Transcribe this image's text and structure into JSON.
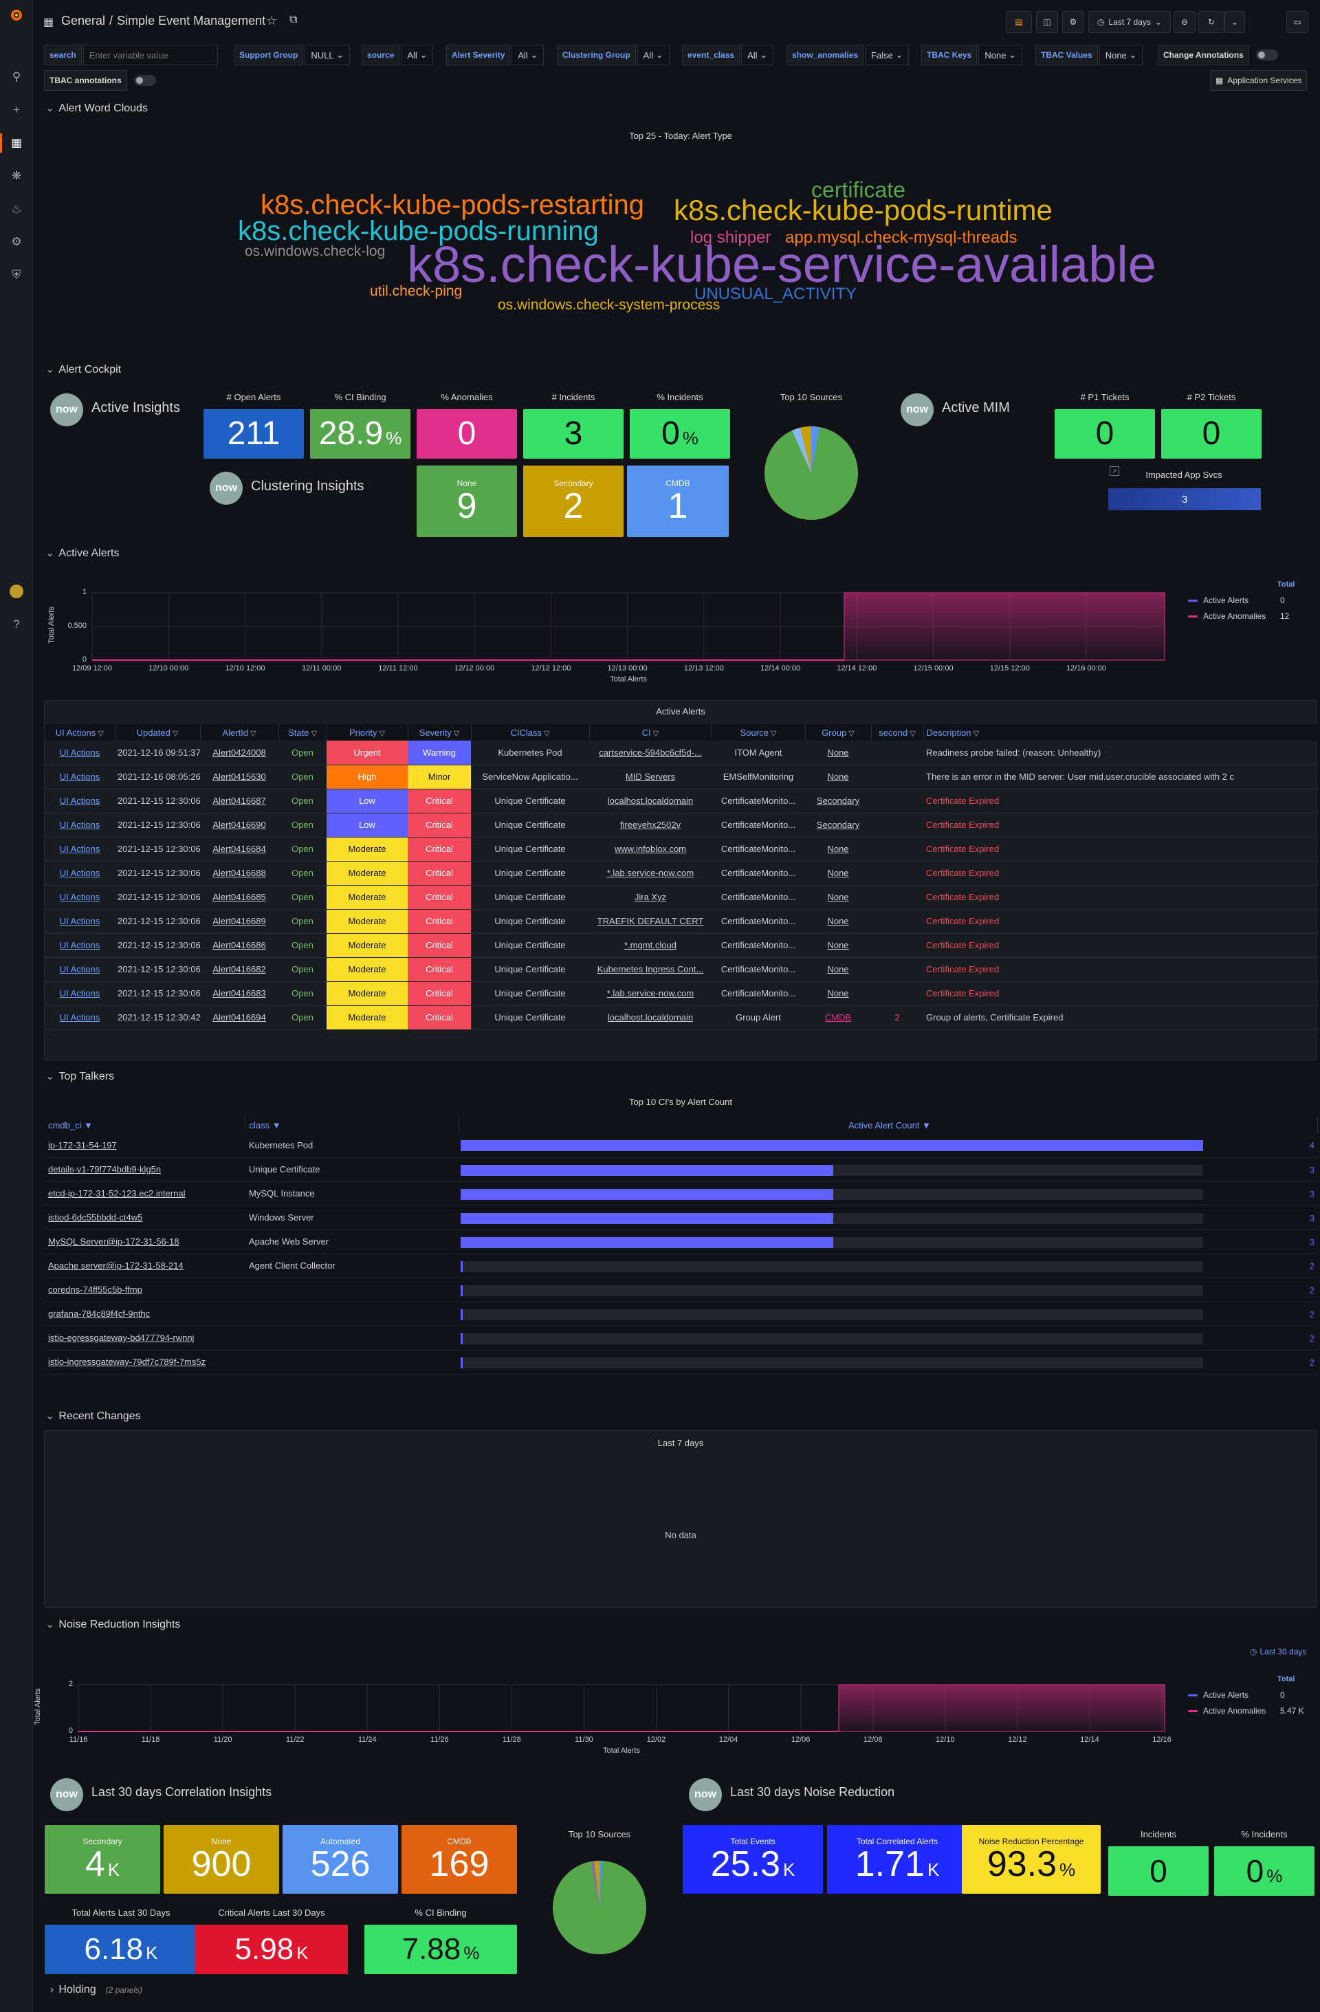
{
  "header": {
    "breadcrumb_folder": "General",
    "breadcrumb_sep": "/",
    "dashboard_title": "Simple Event Management",
    "time_range": "Last 7 days"
  },
  "variables": [
    {
      "label": "search",
      "value": "",
      "placeholder": "Enter variable value"
    },
    {
      "label": "Support Group",
      "value": "NULL"
    },
    {
      "label": "source",
      "value": "All"
    },
    {
      "label": "Alert Severity",
      "value": "All"
    },
    {
      "label": "Clustering Group",
      "value": "All"
    },
    {
      "label": "event_class",
      "value": "All"
    },
    {
      "label": "show_anomalies",
      "value": "False"
    },
    {
      "label": "TBAC Keys",
      "value": "None"
    },
    {
      "label": "TBAC Values",
      "value": "None"
    },
    {
      "label": "Change Annotations",
      "value": ""
    },
    {
      "label": "TBAC annotations",
      "value": ""
    }
  ],
  "app_services_link": "Application Services",
  "rows": {
    "word_clouds": "Alert Word Clouds",
    "cockpit": "Alert Cockpit",
    "active_alerts": "Active Alerts",
    "top_talkers": "Top Talkers",
    "recent_changes": "Recent Changes",
    "noise": "Noise Reduction Insights",
    "holding": "Holding",
    "holding_count": "(2 panels)"
  },
  "word_cloud": {
    "title": "Top 25 - Today: Alert Type",
    "words": [
      {
        "text": "k8s.check-kube-pods-restarting",
        "color": "#ff780a"
      },
      {
        "text": "k8s.check-kube-pods-runtime",
        "color": "#e0b400"
      },
      {
        "text": "certificate",
        "color": "#56a64b"
      },
      {
        "text": "k8s.check-kube-pods-running",
        "color": "#1fc3d6"
      },
      {
        "text": "log shipper",
        "color": "#d44a8a"
      },
      {
        "text": "app.mysql.check-mysql-threads",
        "color": "#ff780a"
      },
      {
        "text": "os.windows.check-log",
        "color": "#8e8e8e"
      },
      {
        "text": "k8s.check-kube-service-available",
        "color": "#8f5fc7"
      },
      {
        "text": "util.check-ping",
        "color": "#ff9830"
      },
      {
        "text": "UNUSUAL_ACTIVITY",
        "color": "#3274d9"
      },
      {
        "text": "os.windows.check-system-process",
        "color": "#e0b400"
      }
    ]
  },
  "cockpit": {
    "active_insights": "Active Insights",
    "clustering_insights": "Clustering Insights",
    "active_mim": "Active MIM",
    "now_logo": "now",
    "stats": [
      {
        "label": "# Open Alerts",
        "value": "211",
        "unit": "",
        "color": "#1f60c4"
      },
      {
        "label": "% CI Binding",
        "value": "28.9",
        "unit": "%",
        "color": "#56a64b"
      },
      {
        "label": "% Anomalies",
        "value": "0",
        "unit": "",
        "color": "#e02f8d"
      },
      {
        "label": "# Incidents",
        "value": "3",
        "unit": "",
        "color": "#37e066"
      },
      {
        "label": "% Incidents",
        "value": "0",
        "unit": "%",
        "color": "#37e066"
      }
    ],
    "groups": [
      {
        "label": "None",
        "value": "9",
        "color": "#56a64b"
      },
      {
        "label": "Secondary",
        "value": "2",
        "color": "#c7a000"
      },
      {
        "label": "CMDB",
        "value": "1",
        "color": "#5794f2"
      }
    ],
    "top_sources_title": "Top 10 Sources",
    "tickets": [
      {
        "label": "# P1 Tickets",
        "value": "0"
      },
      {
        "label": "# P2 Tickets",
        "value": "0"
      }
    ],
    "impacted_title": "Impacted App Svcs",
    "impacted_value": "3"
  },
  "active_alerts_chart": {
    "chart_data": {
      "type": "area",
      "ylabel": "Total Alerts",
      "xlabel": "Total Alerts",
      "x_ticks": [
        "12/09 12:00",
        "12/10 00:00",
        "12/10 12:00",
        "12/11 00:00",
        "12/11 12:00",
        "12/12 00:00",
        "12/12 12:00",
        "12/13 00:00",
        "12/13 12:00",
        "12/14 00:00",
        "12/14 12:00",
        "12/15 00:00",
        "12/15 12:00",
        "12/16 00:00"
      ],
      "y_ticks": [
        "0",
        "0.500",
        "1"
      ],
      "series": [
        {
          "name": "Active Alerts",
          "total": "0",
          "color": "#5f61ff"
        },
        {
          "name": "Active Anomalies",
          "total": "12",
          "color": "#e02f8d"
        }
      ]
    },
    "legend_header": "Total"
  },
  "alerts_table": {
    "title": "Active Alerts",
    "columns": [
      "UI Actions",
      "Updated",
      "AlertId",
      "State",
      "Priority",
      "Severity",
      "CIClass",
      "CI",
      "Source",
      "Group",
      "second",
      "Description"
    ],
    "rows": [
      [
        "UI Actions",
        "2021-12-16 09:51:37.000",
        "Alert0424008",
        "Open",
        "Urgent",
        "Warning",
        "Kubernetes Pod",
        "cartservice-594bc6cf5d-...",
        "ITOM Agent",
        "None",
        "",
        "Readiness probe failed: (reason: Unhealthy)"
      ],
      [
        "UI Actions",
        "2021-12-16 08:05:26.000",
        "Alert0415630",
        "Open",
        "High",
        "Minor",
        "ServiceNow Applicatio...",
        "MID Servers",
        "EMSelfMonitoring",
        "None",
        "",
        "There is an error in the MID server: User mid.user.crucible associated with 2 c"
      ],
      [
        "UI Actions",
        "2021-12-15 12:30:06.000",
        "Alert0416687",
        "Open",
        "Low",
        "Critical",
        "Unique Certificate",
        "localhost.localdomain",
        "CertificateMonito...",
        "Secondary",
        "",
        "Certificate Expired"
      ],
      [
        "UI Actions",
        "2021-12-15 12:30:06.000",
        "Alert0416690",
        "Open",
        "Low",
        "Critical",
        "Unique Certificate",
        "fireeyehx2502v",
        "CertificateMonito...",
        "Secondary",
        "",
        "Certificate Expired"
      ],
      [
        "UI Actions",
        "2021-12-15 12:30:06.000",
        "Alert0416684",
        "Open",
        "Moderate",
        "Critical",
        "Unique Certificate",
        "www.infoblox.com",
        "CertificateMonito...",
        "None",
        "",
        "Certificate Expired"
      ],
      [
        "UI Actions",
        "2021-12-15 12:30:06.000",
        "Alert0416688",
        "Open",
        "Moderate",
        "Critical",
        "Unique Certificate",
        "*.lab.service-now.com",
        "CertificateMonito...",
        "None",
        "",
        "Certificate Expired"
      ],
      [
        "UI Actions",
        "2021-12-15 12:30:06.000",
        "Alert0416685",
        "Open",
        "Moderate",
        "Critical",
        "Unique Certificate",
        "Jira Xyz",
        "CertificateMonito...",
        "None",
        "",
        "Certificate Expired"
      ],
      [
        "UI Actions",
        "2021-12-15 12:30:06.000",
        "Alert0416689",
        "Open",
        "Moderate",
        "Critical",
        "Unique Certificate",
        "TRAEFIK DEFAULT CERT",
        "CertificateMonito...",
        "None",
        "",
        "Certificate Expired"
      ],
      [
        "UI Actions",
        "2021-12-15 12:30:06.000",
        "Alert0416686",
        "Open",
        "Moderate",
        "Critical",
        "Unique Certificate",
        "*.mgmt.cloud",
        "CertificateMonito...",
        "None",
        "",
        "Certificate Expired"
      ],
      [
        "UI Actions",
        "2021-12-15 12:30:06.000",
        "Alert0416682",
        "Open",
        "Moderate",
        "Critical",
        "Unique Certificate",
        "Kubernetes Ingress Cont...",
        "CertificateMonito...",
        "None",
        "",
        "Certificate Expired"
      ],
      [
        "UI Actions",
        "2021-12-15 12:30:06.000",
        "Alert0416683",
        "Open",
        "Moderate",
        "Critical",
        "Unique Certificate",
        "*.lab.service-now.com",
        "CertificateMonito...",
        "None",
        "",
        "Certificate Expired"
      ],
      [
        "UI Actions",
        "2021-12-15 12:30:42.000",
        "Alert0416694",
        "Open",
        "Moderate",
        "Critical",
        "Unique Certificate",
        "localhost.localdomain",
        "Group Alert",
        "CMDB",
        "2",
        "Group of alerts, Certificate Expired"
      ]
    ]
  },
  "top_talkers": {
    "title": "Top 10 CI's by Alert Count",
    "columns": [
      "cmdb_ci",
      "class",
      "Active Alert Count"
    ],
    "rows": [
      {
        "ci": "ip-172-31-54-197",
        "cls": "Kubernetes Pod",
        "count": 4
      },
      {
        "ci": "details-v1-79f774bdb9-klg5n",
        "cls": "Unique Certificate",
        "count": 3
      },
      {
        "ci": "etcd-ip-172-31-52-123.ec2.internal",
        "cls": "MySQL Instance",
        "count": 3
      },
      {
        "ci": "istiod-6dc55bbdd-ct4w5",
        "cls": "Windows Server",
        "count": 3
      },
      {
        "ci": "MySQL Server@ip-172-31-56-18",
        "cls": "Apache Web Server",
        "count": 3
      },
      {
        "ci": "Apache server@ip-172-31-58-214",
        "cls": "Agent Client Collector",
        "count": 2
      },
      {
        "ci": "coredns-74ff55c5b-ffmp",
        "cls": "",
        "count": 2
      },
      {
        "ci": "grafana-784c89f4cf-9nthc",
        "cls": "",
        "count": 2
      },
      {
        "ci": "istio-egressgateway-bd477794-rwnnj",
        "cls": "",
        "count": 2
      },
      {
        "ci": "istio-ingressgateway-79df7c789f-7ms5z",
        "cls": "",
        "count": 2
      }
    ],
    "max": 4
  },
  "recent_changes": {
    "title": "Last 7 days",
    "empty": "No data"
  },
  "noise_chart": {
    "time_badge": "Last 30 days",
    "chart_data": {
      "type": "area",
      "ylabel": "Total Alerts",
      "xlabel": "Total Alerts",
      "x_ticks": [
        "11/16",
        "11/18",
        "11/20",
        "11/22",
        "11/24",
        "11/26",
        "11/28",
        "11/30",
        "12/02",
        "12/04",
        "12/06",
        "12/08",
        "12/10",
        "12/12",
        "12/14",
        "12/16"
      ],
      "y_ticks": [
        "0",
        "2"
      ],
      "series": [
        {
          "name": "Active Alerts",
          "total": "0",
          "color": "#5f61ff"
        },
        {
          "name": "Active Anomalies",
          "total": "5.47 K",
          "color": "#e02f8d"
        }
      ]
    },
    "legend_header": "Total"
  },
  "corr": {
    "title": "Last 30 days Correlation Insights",
    "stats": [
      {
        "label": "Secondary",
        "value": "4",
        "unit": "K",
        "color": "#56a64b"
      },
      {
        "label": "None",
        "value": "900",
        "unit": "",
        "color": "#c7a000"
      },
      {
        "label": "Automated",
        "value": "526",
        "unit": "",
        "color": "#5794f2"
      },
      {
        "label": "CMDB",
        "value": "169",
        "unit": "",
        "color": "#e0610f"
      }
    ],
    "bottom": [
      {
        "label": "Total Alerts Last 30 Days",
        "value": "6.18",
        "unit": "K",
        "color": "#1f60c4"
      },
      {
        "label": "Critical Alerts Last 30 Days",
        "value": "5.98",
        "unit": "K",
        "color": "#e0142d"
      },
      {
        "label": "% CI Binding",
        "value": "7.88",
        "unit": "%",
        "color": "#37e066"
      }
    ],
    "top_sources_title": "Top 10 Sources"
  },
  "noise_red": {
    "title": "Last 30 days Noise Reduction",
    "stats": [
      {
        "label": "Total Events",
        "value": "25.3",
        "unit": "K",
        "color": "#1f2aff"
      },
      {
        "label": "Total Correlated Alerts",
        "value": "1.71",
        "unit": "K",
        "color": "#1f2aff"
      },
      {
        "label": "Noise Reduction Percentage",
        "value": "93.3",
        "unit": "%",
        "color": "#fade2a"
      }
    ],
    "extra": [
      {
        "label": "Incidents",
        "value": "0",
        "unit": ""
      },
      {
        "label": "% Incidents",
        "value": "0",
        "unit": "%"
      }
    ]
  }
}
